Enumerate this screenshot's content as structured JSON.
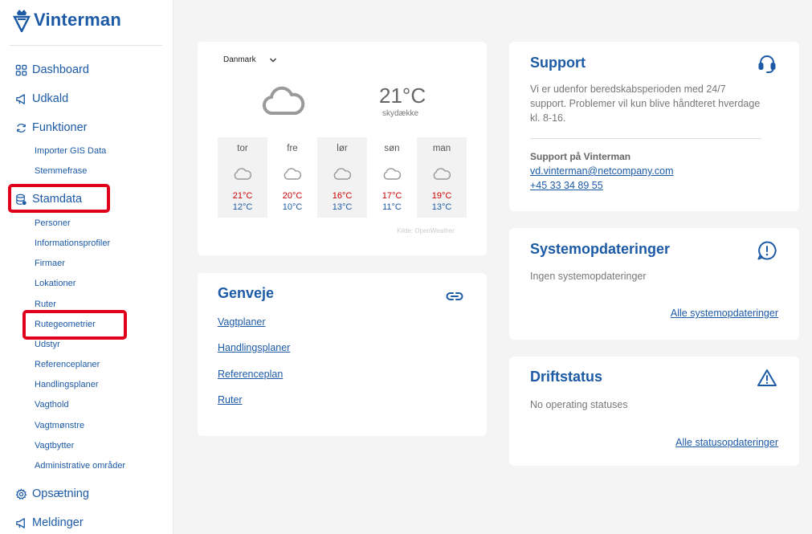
{
  "brand": {
    "name": "Vinterman",
    "accent": "#1c5aa6",
    "highlight": "#e0001b"
  },
  "sidebar": {
    "items": [
      {
        "label": "Dashboard",
        "icon": "grid-icon"
      },
      {
        "label": "Udkald",
        "icon": "megaphone-icon"
      },
      {
        "label": "Funktioner",
        "icon": "refresh-icon"
      },
      {
        "label": "Stamdata",
        "icon": "database-icon"
      },
      {
        "label": "Opsætning",
        "icon": "gear-icon"
      },
      {
        "label": "Meldinger",
        "icon": "megaphone-icon"
      }
    ],
    "funktioner_sub": [
      "Importer GIS Data",
      "Stemmefrase"
    ],
    "stamdata_sub": [
      "Personer",
      "Informationsprofiler",
      "Firmaer",
      "Lokationer",
      "Ruter",
      "Rutegeometrier",
      "Udstyr",
      "Referenceplaner",
      "Handlingsplaner",
      "Vagthold",
      "Vagtmønstre",
      "Vagtbytter",
      "Administrative områder"
    ]
  },
  "weather": {
    "country": "Danmark",
    "current_temp": "21°C",
    "current_desc": "skydække",
    "icon": "cloud-icon",
    "forecast": [
      {
        "day": "tor",
        "hi": "21°C",
        "lo": "12°C"
      },
      {
        "day": "fre",
        "hi": "20°C",
        "lo": "10°C"
      },
      {
        "day": "lør",
        "hi": "16°C",
        "lo": "13°C"
      },
      {
        "day": "søn",
        "hi": "17°C",
        "lo": "11°C"
      },
      {
        "day": "man",
        "hi": "19°C",
        "lo": "13°C"
      }
    ],
    "source": "Kilde: OpenWeather"
  },
  "genveje": {
    "title": "Genveje",
    "links": [
      "Vagtplaner",
      "Handlingsplaner",
      "Referenceplan",
      "Ruter"
    ]
  },
  "support": {
    "title": "Support",
    "text": "Vi er udenfor beredskabsperioden med 24/7 support. Problemer vil kun blive håndteret hverdage kl. 8-16.",
    "sub_title": "Support på Vinterman",
    "email": "vd.vinterman@netcompany.com",
    "phone": "+45 33 34 89 55"
  },
  "systemopdateringer": {
    "title": "Systemopdateringer",
    "text": "Ingen systemopdateringer",
    "link": "Alle systemopdateringer"
  },
  "driftstatus": {
    "title": "Driftstatus",
    "text": "No operating statuses",
    "link": "Alle statusopdateringer"
  }
}
